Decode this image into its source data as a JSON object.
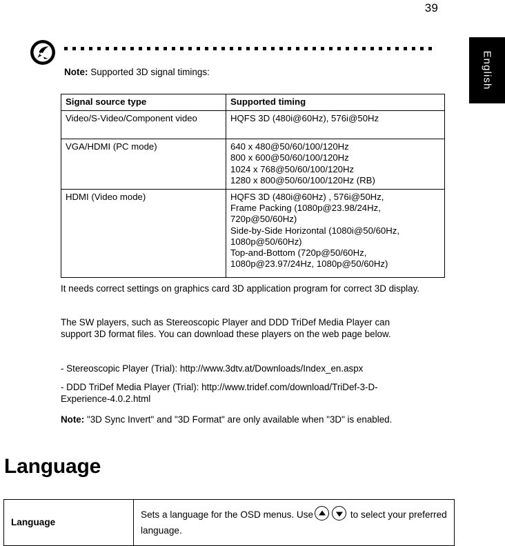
{
  "page": {
    "number": "39",
    "side_tab_label": "English"
  },
  "note_block": {
    "icon": "acer-note-pen-icon",
    "label": "Note:",
    "text": "Supported 3D signal timings:"
  },
  "timings_table": {
    "headers": [
      "Signal source type",
      "Supported timing"
    ],
    "rows": [
      {
        "source": "Video/S-Video/Component video",
        "timing": "HQFS 3D (480i@60Hz), 576i@50Hz"
      },
      {
        "source": "VGA/HDMI (PC mode)",
        "timing": "640 x 480@50/60/100/120Hz\n800 x 600@50/60/100/120Hz\n1024 x 768@50/60/100/120Hz\n1280 x 800@50/60/100/120Hz (RB)"
      },
      {
        "source": "HDMI (Video mode)",
        "timing": "HQFS 3D (480i@60Hz) , 576i@50Hz,\nFrame Packing (1080p@23.98/24Hz,\n720p@50/60Hz)\nSide-by-Side Horizontal (1080i@50/60Hz,\n1080p@50/60Hz)\nTop-and-Bottom (720p@50/60Hz,\n1080p@23.97/24Hz, 1080p@50/60Hz)"
      }
    ]
  },
  "body": {
    "paragraph_1": "It needs correct settings on graphics card 3D application program for correct 3D display.",
    "paragraph_2": "The SW players, such as Stereoscopic Player and DDD TriDef Media Player can support 3D format files. You can download these players on the web page below.",
    "link_1": "- Stereoscopic Player (Trial): http://www.3dtv.at/Downloads/Index_en.aspx",
    "link_2": "- DDD TriDef Media Player (Trial): http://www.tridef.com/download/TriDef-3-D-Experience-4.0.2.html",
    "note_2_label": "Note:",
    "note_2_text": "\"3D Sync Invert\" and \"3D Format\" are only available when \"3D\" is enabled."
  },
  "language_section": {
    "heading": "Language",
    "table": {
      "row_label": "Language",
      "description_before": "Sets a language for the OSD menus. Use",
      "up_icon": "arrow-up-icon",
      "down_icon": "arrow-down-icon",
      "description_after": "to select your preferred language."
    }
  }
}
